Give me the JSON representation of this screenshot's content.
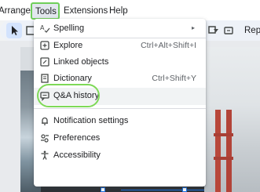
{
  "menubar": {
    "items": [
      "Arrange",
      "Tools",
      "Extensions",
      "Help"
    ]
  },
  "toolbar": {
    "rep_text": "Rep"
  },
  "tools_menu": {
    "items": [
      {
        "label": "Spelling",
        "shortcut": "",
        "submenu": true,
        "icon": "spelling-icon"
      },
      {
        "label": "Explore",
        "shortcut": "Ctrl+Alt+Shift+I",
        "icon": "explore-icon"
      },
      {
        "label": "Linked objects",
        "shortcut": "",
        "icon": "linked-objects-icon"
      },
      {
        "label": "Dictionary",
        "shortcut": "Ctrl+Shift+Y",
        "icon": "dictionary-icon"
      },
      {
        "label": "Q&A history",
        "shortcut": "",
        "icon": "qa-history-icon"
      },
      {
        "label": "Notification settings",
        "shortcut": "",
        "icon": "bell-icon"
      },
      {
        "label": "Preferences",
        "shortcut": "",
        "icon": "preferences-icon"
      },
      {
        "label": "Accessibility",
        "shortcut": "",
        "icon": "accessibility-icon"
      }
    ]
  },
  "colors": {
    "highlight_ring": "#7ed957",
    "selection": "#1a73e8"
  }
}
